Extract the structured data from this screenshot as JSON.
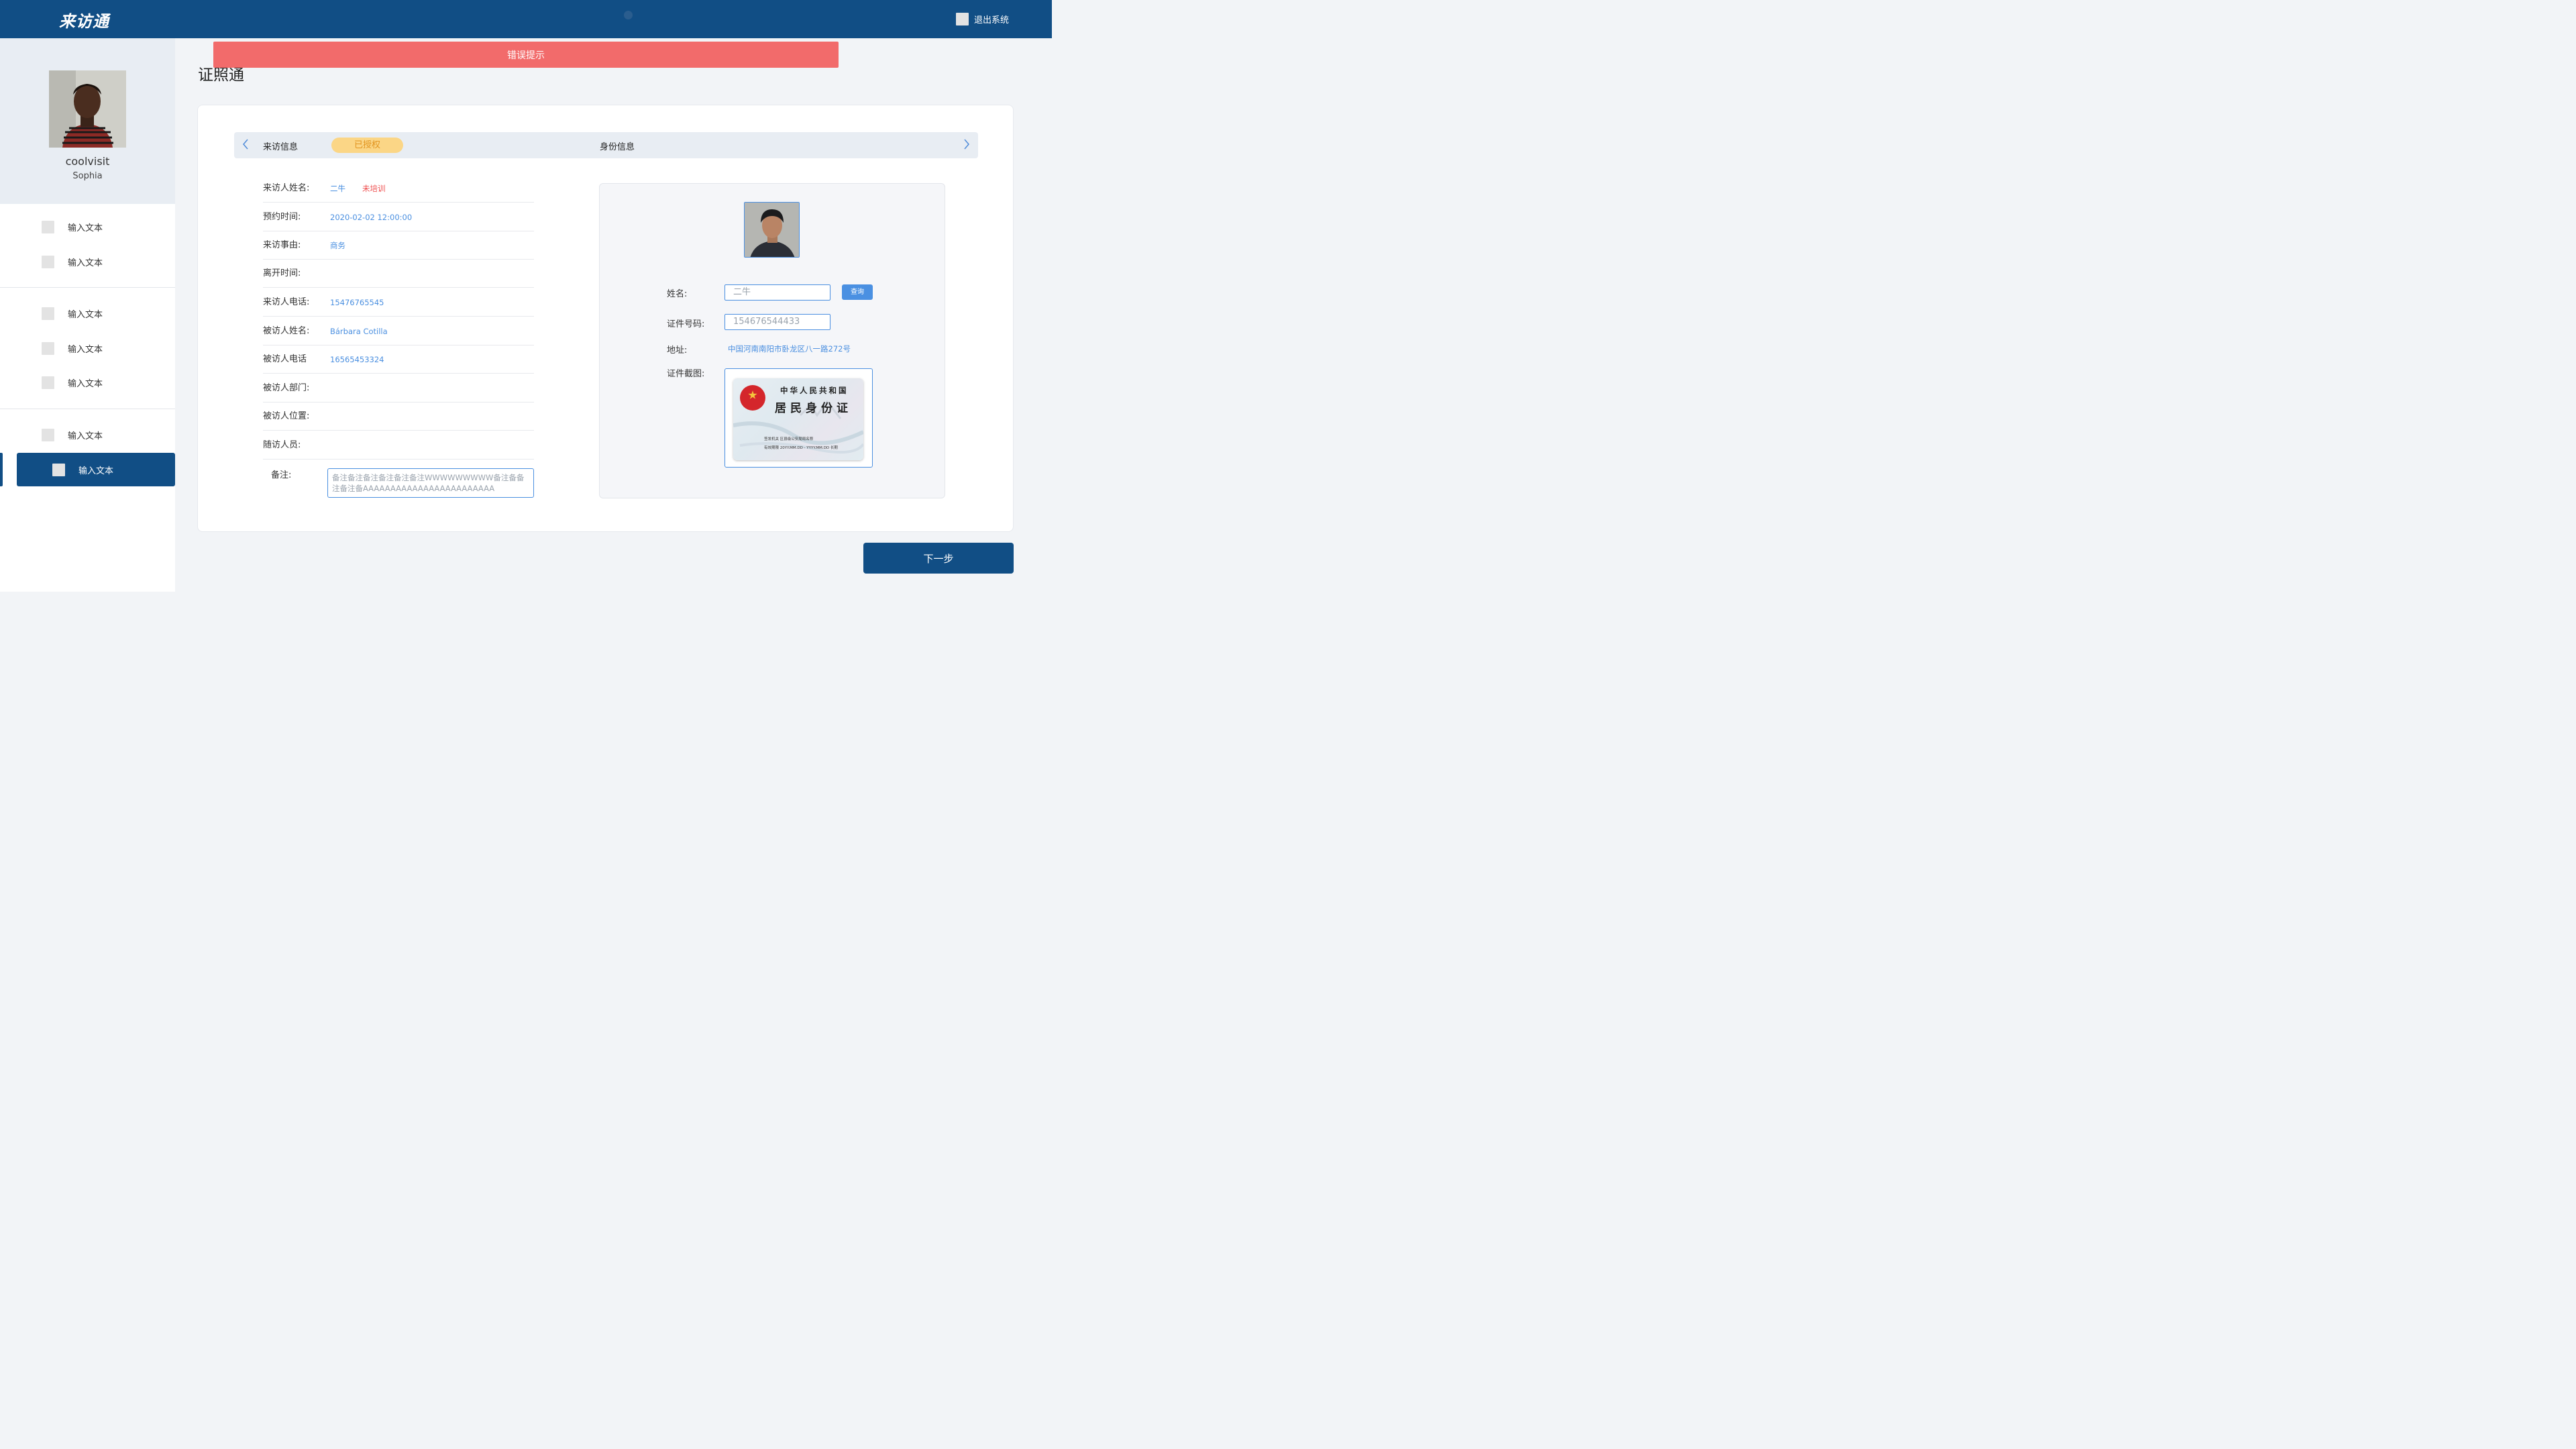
{
  "header": {
    "logo": "来访通",
    "logout_label": "退出系统"
  },
  "sidebar": {
    "username": "coolvisit",
    "subname": "Sophia",
    "items": [
      {
        "label": "输入文本"
      },
      {
        "label": "输入文本"
      },
      {
        "label": "输入文本"
      },
      {
        "label": "输入文本"
      },
      {
        "label": "输入文本"
      },
      {
        "label": "输入文本"
      },
      {
        "label": "输入文本",
        "active": true
      }
    ]
  },
  "error_banner": "错误提示",
  "page_title": "证照通",
  "stepbar": {
    "step1": "来访信息",
    "badge": "已授权",
    "step2": "身份信息"
  },
  "visitor": {
    "rows": [
      {
        "label": "来访人姓名:",
        "value": "二牛",
        "tag": "未培训"
      },
      {
        "label": "预约时间:",
        "value": "2020-02-02 12:00:00"
      },
      {
        "label": "来访事由:",
        "value": "商务"
      },
      {
        "label": "离开时间:",
        "value": ""
      },
      {
        "label": "来访人电话:",
        "value": "15476765545"
      },
      {
        "label": "被访人姓名:",
        "value": "Bárbara Cotilla"
      },
      {
        "label": "被访人电话",
        "value": "16565453324"
      },
      {
        "label": "被访人部门:",
        "value": ""
      },
      {
        "label": "被访人位置:",
        "value": ""
      },
      {
        "label": "随访人员:",
        "value": ""
      }
    ],
    "remark_label": "备注:",
    "remark_placeholder": "备注备注备注备注备注备注WWWWWWWWW备注备备注备注备AAAAAAAAAAAAAAAAAAAAAAAA"
  },
  "identity": {
    "name_label": "姓名:",
    "name_placeholder": "二牛",
    "query_label": "查询",
    "id_label": "证件号码:",
    "id_placeholder": "154676544433",
    "address_label": "地址:",
    "address_value": "中国河南南阳市卧龙区八一路272号",
    "screenshot_label": "证件截图:",
    "card": {
      "line1": "中华人民共和国",
      "line2": "居民身份证",
      "authority": "签发机关    区县级公安局局名称",
      "validity": "有效期限    20YY.MM.DD - YYYY.MM.DD 长期"
    }
  },
  "next_label": "下一步"
}
